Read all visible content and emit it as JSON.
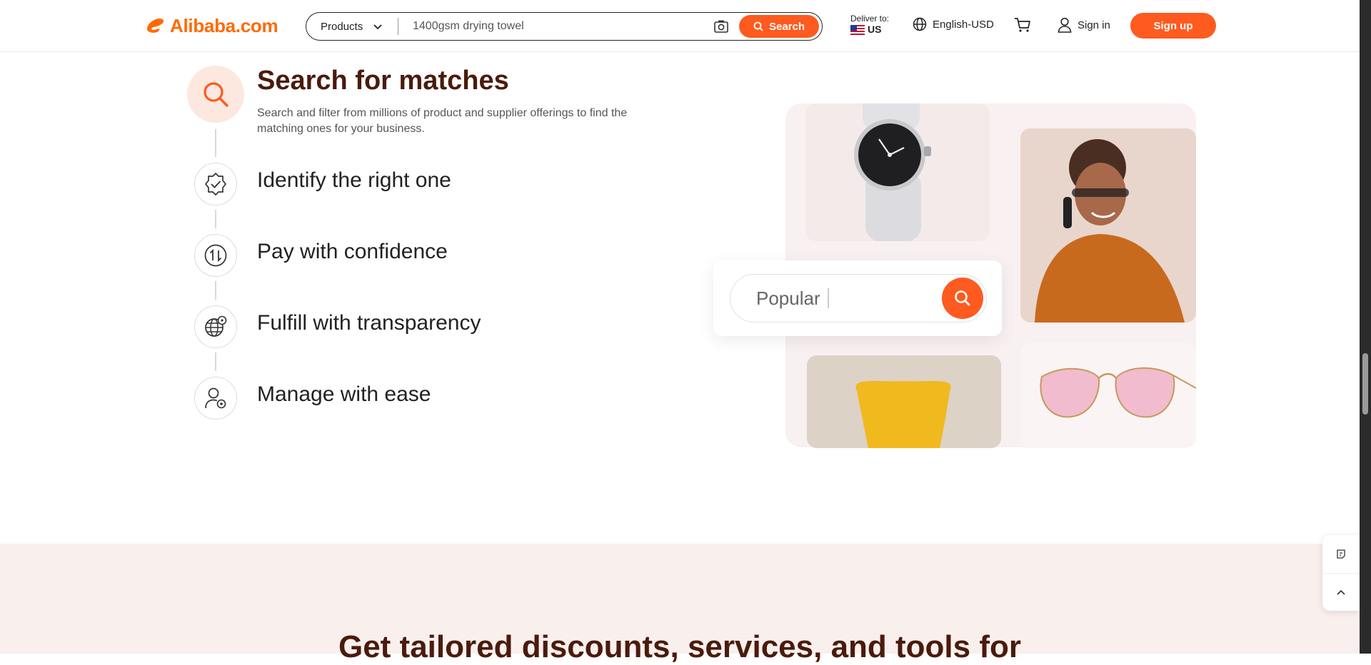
{
  "header": {
    "logo_text": "Alibaba.com",
    "search": {
      "category": "Products",
      "query": "1400gsm drying towel",
      "button_label": "Search"
    },
    "deliver": {
      "label": "Deliver to:",
      "country": "US"
    },
    "language": "English-USD",
    "sign_in": "Sign in",
    "sign_up": "Sign up"
  },
  "steps": [
    {
      "title": "Search for matches",
      "desc": "Search and filter from millions of product and supplier offerings to find the matching ones for your business.",
      "icon": "search-icon",
      "active": true
    },
    {
      "title": "Identify the right one",
      "icon": "verified-badge-icon",
      "active": false
    },
    {
      "title": "Pay with confidence",
      "icon": "payment-exchange-icon",
      "active": false
    },
    {
      "title": "Fulfill with transparency",
      "icon": "globe-icon",
      "active": false
    },
    {
      "title": "Manage with ease",
      "icon": "user-settings-icon",
      "active": false
    }
  ],
  "illustration": {
    "search_placeholder": "Popular"
  },
  "bottom": {
    "heading": "Get tailored discounts, services, and tools for"
  },
  "colors": {
    "brand_orange": "#ff5a1f",
    "heading_brown": "#4a1b0c",
    "section_bg": "#f9f0ee"
  }
}
